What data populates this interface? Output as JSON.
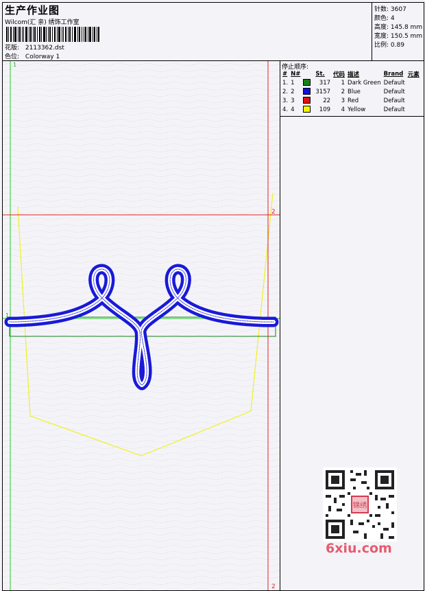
{
  "header": {
    "title": "生产作业图",
    "company": "Wilcom(汇 亲) 绣饰工作室",
    "design_label": "花版:",
    "design_value": "2113362.dst",
    "colorway_label": "色位:",
    "colorway_value": "Colorway 1"
  },
  "stats": {
    "stitches_label": "针数:",
    "stitches_value": "3607",
    "colors_label": "颜色:",
    "colors_value": "4",
    "height_label": "高度:",
    "height_value": "145.8 mm",
    "width_label": "宽度:",
    "width_value": "150.5 mm",
    "ratio_label": "比例:",
    "ratio_value": "0.89"
  },
  "threads": {
    "title": "停止顺序:",
    "headers": [
      "#",
      "N#",
      "St.",
      "代码",
      "描述",
      "Brand",
      "元素"
    ],
    "rows": [
      {
        "seq": "1.",
        "n": "1",
        "color": "#1a7f1a",
        "st": "317",
        "code": "1",
        "desc": "Dark Green",
        "brand": "Default"
      },
      {
        "seq": "2.",
        "n": "2",
        "color": "#1010e0",
        "st": "3157",
        "code": "2",
        "desc": "Blue",
        "brand": "Default"
      },
      {
        "seq": "3.",
        "n": "3",
        "color": "#e01010",
        "st": "22",
        "code": "3",
        "desc": "Red",
        "brand": "Default"
      },
      {
        "seq": "4.",
        "n": "4",
        "color": "#f5f500",
        "st": "109",
        "code": "4",
        "desc": "Yellow",
        "brand": "Default"
      }
    ]
  },
  "guides": {
    "green_top": "1",
    "green_mid": "1",
    "red_mid": "2",
    "red_bottom": "2"
  },
  "colors": {
    "blue": "#1a1ad8",
    "yellow": "#f0f020",
    "green": "#22cc22",
    "red": "#e02020"
  },
  "watermark": {
    "text": "6xiu.com",
    "qr_stamp": "锦绣"
  }
}
